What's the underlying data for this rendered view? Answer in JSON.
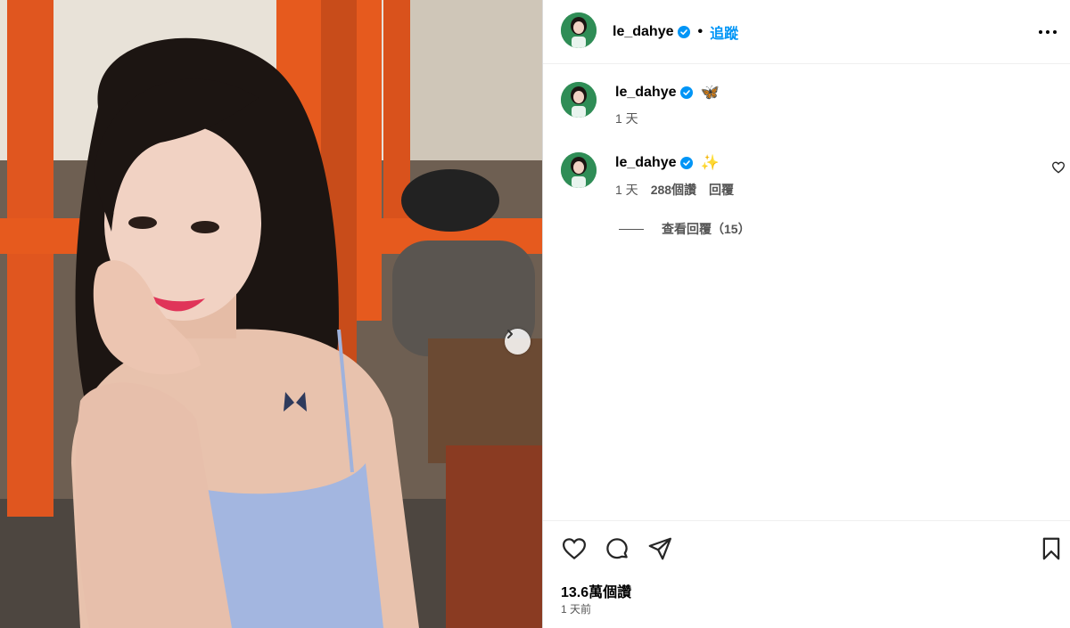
{
  "post": {
    "username": "le_dahye",
    "follow_label": "追蹤",
    "dot": "•",
    "next_icon": "chevron-right-icon"
  },
  "caption": {
    "username": "le_dahye",
    "emoji": "🦋",
    "time": "1 天"
  },
  "comment": {
    "username": "le_dahye",
    "emoji": "✨",
    "time": "1 天",
    "likes": "288個讚",
    "reply_label": "回覆",
    "view_replies": "查看回覆（15）"
  },
  "footer": {
    "likes": "13.6萬個讚",
    "time_ago": "1 天前"
  },
  "colors": {
    "accent": "#0095f6",
    "verified": "#0095f6",
    "avatar_bg": "#2f8d56"
  }
}
